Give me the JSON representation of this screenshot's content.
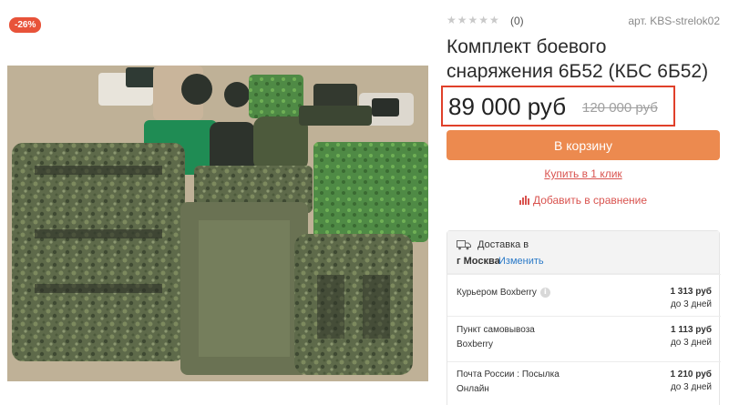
{
  "badge": {
    "discount": "-26%"
  },
  "rating": {
    "stars": "★★★★★",
    "count": "(0)"
  },
  "sku": "арт. KBS-strelok02",
  "product": {
    "title_line1": "Комплект боевого",
    "title_line2": "снаряжения 6Б52 (КБС 6Б52)"
  },
  "price": {
    "current": "89 000 руб",
    "old": "120 000 руб",
    "highlight_color": "#e0402a"
  },
  "actions": {
    "cart_label": "В корзину",
    "one_click_label": "Купить в 1 клик",
    "compare_label": "Добавить в сравнение"
  },
  "delivery": {
    "title": "Доставка в",
    "city": "г Москва",
    "change_label": "Изменить",
    "methods": [
      {
        "name": "Курьером Boxberry",
        "price": "1 313 руб",
        "days": "до 3 дней"
      },
      {
        "name_line1": "Пункт самовывоза",
        "name_line2": "Boxberry",
        "price": "1 113 руб",
        "days": "до 3 дней"
      },
      {
        "name_line1": "Почта России : Посылка",
        "name_line2": "Онлайн",
        "price": "1 210 руб",
        "days": "до 3 дней"
      }
    ]
  },
  "colors": {
    "accent": "#ec8a4f",
    "link": "#d9534f",
    "badge": "#e8533a"
  }
}
